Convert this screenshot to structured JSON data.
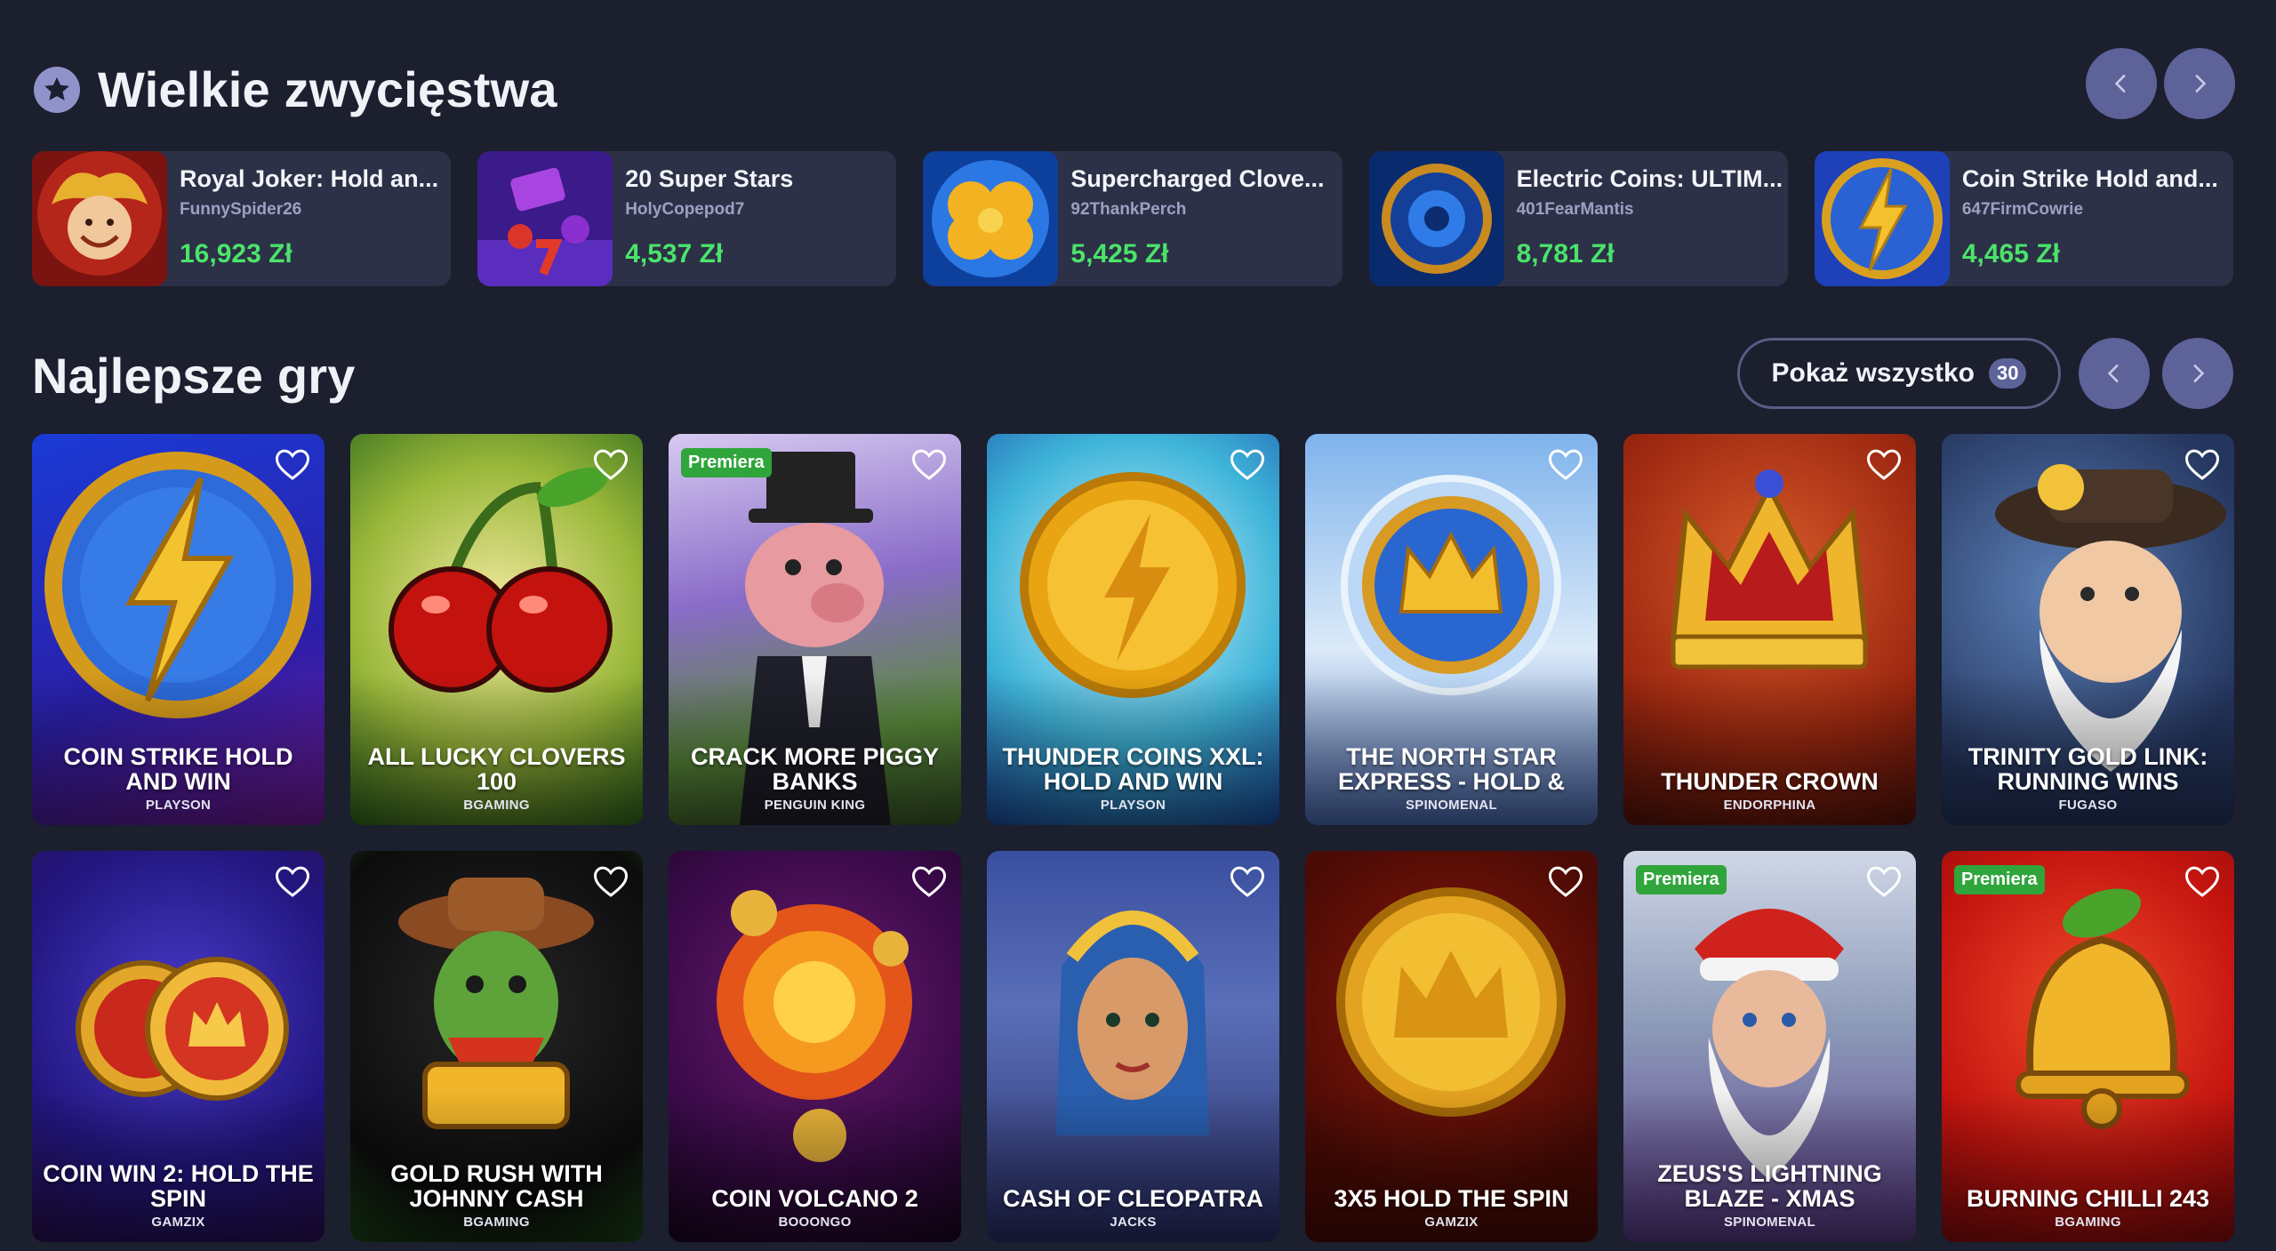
{
  "wins": {
    "title": "Wielkie zwycięstwa",
    "items": [
      {
        "game": "Royal Joker: Hold an...",
        "user": "FunnySpider26",
        "amount": "16,923 Zł"
      },
      {
        "game": "20 Super Stars",
        "user": "HolyCopepod7",
        "amount": "4,537 Zł"
      },
      {
        "game": "Supercharged Clove...",
        "user": "92ThankPerch",
        "amount": "5,425 Zł"
      },
      {
        "game": "Electric Coins: ULTIM...",
        "user": "401FearMantis",
        "amount": "8,781 Zł"
      },
      {
        "game": "Coin Strike Hold and...",
        "user": "647FirmCowrie",
        "amount": "4,465 Zł"
      }
    ],
    "thumb_icons": [
      "joker-icon",
      "bar-sevens-icon",
      "clover-icon",
      "electric-coin-icon",
      "lightning-coin-icon"
    ]
  },
  "top_games": {
    "title": "Najlepsze gry",
    "show_all_label": "Pokaż wszystko",
    "show_all_count": "30",
    "badge_label": "Premiera",
    "tiles": [
      {
        "name": "COIN STRIKE HOLD AND WIN",
        "provider": "PLAYSON",
        "premiere": false,
        "art": "lightning-coin"
      },
      {
        "name": "ALL LUCKY CLOVERS 100",
        "provider": "BGAMING",
        "premiere": false,
        "art": "cherries"
      },
      {
        "name": "CRACK MORE PIGGY BANKS",
        "provider": "PENGUIN KING",
        "premiere": true,
        "art": "pig"
      },
      {
        "name": "THUNDER COINS XXL: HOLD AND WIN",
        "provider": "PLAYSON",
        "premiere": false,
        "art": "thunder-coin"
      },
      {
        "name": "THE NORTH STAR EXPRESS - HOLD &",
        "provider": "SPINOMENAL",
        "premiere": false,
        "art": "crown-coin"
      },
      {
        "name": "THUNDER CROWN",
        "provider": "ENDORPHINA",
        "premiere": false,
        "art": "crown"
      },
      {
        "name": "TRINITY GOLD LINK: RUNNING WINS",
        "provider": "FUGASO",
        "premiere": false,
        "art": "miner"
      },
      {
        "name": "COIN WIN 2: HOLD THE SPIN",
        "provider": "GAMZIX",
        "premiere": false,
        "art": "two-coins"
      },
      {
        "name": "GOLD RUSH WITH JOHNNY CASH",
        "provider": "BGAMING",
        "premiere": false,
        "art": "cactus"
      },
      {
        "name": "COIN VOLCANO 2",
        "provider": "BOOONGO",
        "premiere": false,
        "art": "fire-swirl"
      },
      {
        "name": "CASH OF CLEOPATRA",
        "provider": "JACKS",
        "premiere": false,
        "art": "cleopatra"
      },
      {
        "name": "3X5 HOLD THE SPIN",
        "provider": "GAMZIX",
        "premiere": false,
        "art": "gold-crown-coin"
      },
      {
        "name": "ZEUS'S LIGHTNING BLAZE - XMAS",
        "provider": "SPINOMENAL",
        "premiere": true,
        "art": "zeus"
      },
      {
        "name": "BURNING CHILLI 243",
        "provider": "BGAMING",
        "premiere": true,
        "art": "bell"
      }
    ]
  },
  "colors": {
    "background": "#1b1f2e",
    "card": "#2c3147",
    "accent": "#5d6299",
    "win_green": "#4be36a",
    "premiere_green": "#2fa53b"
  }
}
